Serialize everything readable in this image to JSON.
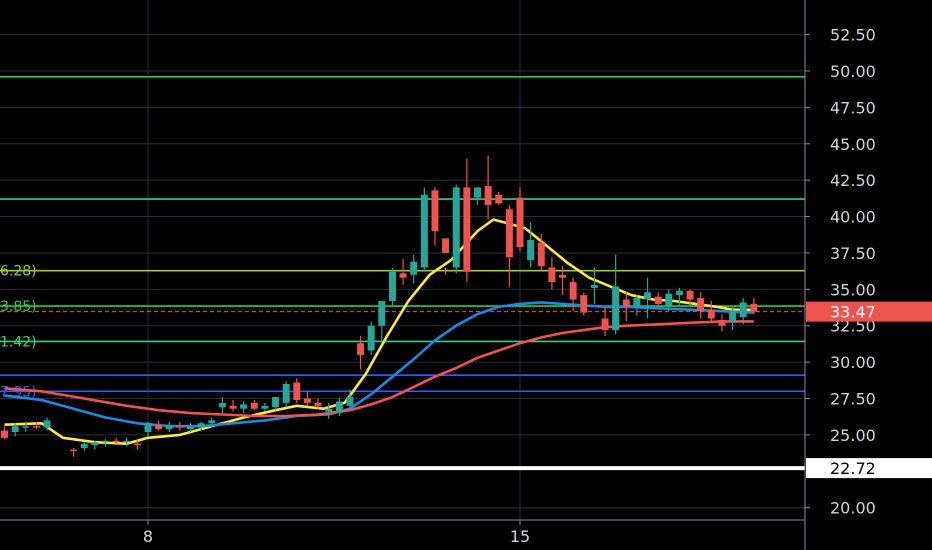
{
  "chart_data": {
    "type": "candlestick",
    "title": "",
    "xlabel": "",
    "ylabel": "",
    "ylim": [
      19.5,
      53.5
    ],
    "y_ticks": [
      "52.50",
      "50.00",
      "47.50",
      "45.00",
      "42.50",
      "40.00",
      "37.50",
      "35.00",
      "32.50",
      "30.00",
      "27.50",
      "25.00",
      "20.00"
    ],
    "x_ticks": [
      {
        "x": 8,
        "label": "8"
      },
      {
        "x": 15,
        "label": "15"
      }
    ],
    "x_range": [
      5.25,
      17.47
    ],
    "grid": true,
    "price_tag": {
      "value": 33.47,
      "label": "33.47",
      "color": "#ef5350"
    },
    "low_tag": {
      "value": 22.72,
      "label": "22.72",
      "color": "#ffffff"
    },
    "horizontal_levels": [
      {
        "value": 49.6,
        "color": "#2ecc40",
        "label": ""
      },
      {
        "value": 41.2,
        "color": "#3ccf7a",
        "label": ""
      },
      {
        "value": 36.28,
        "color": "#9acd32",
        "label": "6.28)"
      },
      {
        "value": 33.85,
        "color": "#2ecc40",
        "label": "3.85)"
      },
      {
        "value": 31.42,
        "color": "#3ccf7a",
        "label": "1.42)"
      },
      {
        "value": 29.1,
        "color": "#2962ff",
        "label": ""
      },
      {
        "value": 28.0,
        "color": "#2962ff",
        "label": "7.95)"
      }
    ],
    "candles": [
      [
        5.3,
        25.3,
        25.6,
        24.7,
        24.8
      ],
      [
        5.5,
        25.2,
        25.8,
        24.9,
        25.6
      ],
      [
        5.7,
        25.5,
        25.9,
        25.2,
        25.6
      ],
      [
        5.9,
        25.6,
        25.9,
        25.4,
        25.5
      ],
      [
        6.1,
        25.5,
        26.2,
        25.3,
        26.0
      ],
      [
        6.6,
        24.0,
        24.1,
        23.5,
        23.9
      ],
      [
        6.8,
        24.1,
        24.5,
        23.9,
        24.4
      ],
      [
        7.0,
        24.3,
        24.6,
        24.0,
        24.5
      ],
      [
        7.2,
        24.5,
        24.7,
        24.2,
        24.6
      ],
      [
        7.4,
        24.6,
        24.8,
        24.3,
        24.5
      ],
      [
        7.6,
        24.5,
        24.8,
        24.2,
        24.6
      ],
      [
        7.8,
        24.4,
        24.7,
        24.0,
        24.3
      ],
      [
        8.0,
        25.2,
        25.9,
        24.9,
        25.8
      ],
      [
        8.2,
        25.7,
        26.0,
        25.3,
        25.4
      ],
      [
        8.4,
        25.4,
        25.9,
        25.2,
        25.7
      ],
      [
        8.6,
        25.6,
        25.9,
        25.3,
        25.5
      ],
      [
        8.8,
        25.4,
        25.8,
        25.2,
        25.6
      ],
      [
        9.0,
        25.5,
        25.9,
        25.3,
        25.8
      ],
      [
        9.2,
        25.8,
        26.2,
        25.5,
        26.0
      ],
      [
        9.4,
        26.9,
        27.6,
        26.5,
        27.2
      ],
      [
        9.6,
        27.0,
        27.4,
        26.6,
        26.8
      ],
      [
        9.8,
        26.8,
        27.3,
        26.5,
        27.1
      ],
      [
        10.0,
        27.2,
        27.4,
        26.7,
        26.8
      ],
      [
        10.2,
        26.8,
        27.2,
        26.6,
        27.0
      ],
      [
        10.4,
        26.9,
        27.6,
        26.7,
        27.6
      ],
      [
        10.6,
        27.2,
        28.7,
        26.9,
        28.5
      ],
      [
        10.8,
        28.6,
        28.9,
        27.2,
        27.4
      ],
      [
        11.0,
        27.5,
        28.0,
        27.0,
        27.2
      ],
      [
        11.2,
        27.2,
        27.5,
        26.8,
        27.0
      ],
      [
        11.4,
        26.6,
        27.2,
        26.1,
        26.8
      ],
      [
        11.6,
        26.5,
        27.5,
        26.3,
        27.3
      ],
      [
        11.8,
        27.0,
        28.1,
        26.7,
        27.6
      ],
      [
        12.0,
        31.3,
        31.8,
        29.5,
        30.5
      ],
      [
        12.2,
        30.8,
        32.8,
        30.5,
        32.5
      ],
      [
        12.4,
        32.5,
        34.0,
        31.5,
        34.2
      ],
      [
        12.6,
        34.2,
        36.5,
        33.8,
        36.2
      ],
      [
        12.8,
        36.1,
        37.1,
        35.3,
        35.8
      ],
      [
        13.0,
        36.0,
        37.4,
        35.4,
        36.9
      ],
      [
        13.2,
        36.5,
        42.0,
        36.2,
        41.5
      ],
      [
        13.4,
        41.8,
        42.0,
        38.0,
        39.0
      ],
      [
        13.6,
        38.5,
        36.5,
        36.0,
        37.5
      ],
      [
        13.8,
        36.5,
        42.2,
        36.1,
        42.0
      ],
      [
        14.0,
        42.0,
        44.0,
        35.5,
        36.2
      ],
      [
        14.2,
        41.3,
        42.0,
        40.8,
        42.0
      ],
      [
        14.4,
        42.1,
        44.2,
        39.8,
        40.8
      ],
      [
        14.6,
        41.5,
        41.7,
        40.8,
        40.9
      ],
      [
        14.8,
        40.5,
        40.8,
        35.2,
        37.2
      ],
      [
        15.0,
        41.3,
        42.0,
        37.6,
        37.9
      ],
      [
        15.2,
        37.0,
        39.6,
        36.5,
        38.4
      ],
      [
        15.4,
        38.2,
        38.8,
        36.3,
        36.6
      ],
      [
        15.6,
        36.5,
        37.2,
        35.0,
        35.5
      ],
      [
        15.8,
        36.0,
        36.6,
        34.6,
        35.8
      ],
      [
        16.0,
        35.5,
        35.8,
        33.5,
        34.3
      ],
      [
        16.2,
        34.6,
        34.8,
        33.2,
        33.4
      ],
      [
        16.4,
        35.1,
        36.5,
        34.0,
        35.3
      ],
      [
        16.6,
        33.0,
        33.8,
        31.8,
        32.2
      ],
      [
        16.8,
        32.2,
        37.4,
        31.9,
        35.2
      ],
      [
        17.0,
        34.3,
        34.8,
        32.8,
        33.8
      ],
      [
        17.2,
        33.8,
        34.6,
        33.2,
        34.4
      ],
      [
        17.4,
        34.3,
        35.8,
        33.0,
        34.8
      ],
      [
        17.6,
        34.5,
        34.8,
        33.8,
        34.0
      ],
      [
        17.8,
        33.9,
        35.0,
        33.5,
        34.7
      ],
      [
        18.0,
        34.6,
        35.1,
        33.8,
        34.9
      ],
      [
        18.2,
        34.9,
        35.0,
        33.9,
        34.3
      ],
      [
        18.4,
        34.4,
        34.8,
        33.0,
        33.5
      ],
      [
        18.6,
        33.6,
        34.2,
        32.7,
        33.0
      ],
      [
        18.8,
        32.9,
        33.3,
        32.1,
        32.5
      ],
      [
        19.0,
        32.8,
        33.8,
        32.2,
        33.5
      ],
      [
        19.2,
        33.1,
        34.4,
        32.6,
        34.1
      ],
      [
        19.4,
        34.0,
        34.4,
        33.3,
        33.47
      ]
    ],
    "series": [
      {
        "color": "#ffeb3b",
        "values": [
          [
            5.3,
            25.7
          ],
          [
            6.0,
            25.8
          ],
          [
            6.4,
            24.8
          ],
          [
            7.0,
            24.5
          ],
          [
            7.6,
            24.4
          ],
          [
            8.0,
            24.8
          ],
          [
            8.6,
            25.0
          ],
          [
            9.2,
            25.6
          ],
          [
            9.8,
            26.2
          ],
          [
            10.4,
            26.7
          ],
          [
            10.8,
            27.0
          ],
          [
            11.3,
            26.8
          ],
          [
            11.7,
            27.2
          ],
          [
            12.1,
            29.2
          ],
          [
            12.5,
            31.8
          ],
          [
            12.9,
            34.2
          ],
          [
            13.3,
            36.0
          ],
          [
            13.7,
            37.0
          ],
          [
            14.2,
            39.0
          ],
          [
            14.5,
            39.8
          ],
          [
            14.8,
            39.5
          ],
          [
            15.1,
            39.2
          ],
          [
            15.5,
            38.0
          ],
          [
            15.9,
            36.8
          ],
          [
            16.3,
            35.8
          ],
          [
            16.7,
            35.2
          ],
          [
            17.1,
            34.6
          ],
          [
            17.5,
            34.3
          ],
          [
            17.9,
            34.2
          ],
          [
            18.3,
            34.0
          ],
          [
            18.7,
            33.8
          ],
          [
            19.0,
            33.6
          ],
          [
            19.4,
            33.6
          ]
        ]
      },
      {
        "color": "#1e88e5",
        "values": [
          [
            5.3,
            27.7
          ],
          [
            6.0,
            27.4
          ],
          [
            6.6,
            26.8
          ],
          [
            7.2,
            26.2
          ],
          [
            7.8,
            25.8
          ],
          [
            8.4,
            25.6
          ],
          [
            9.0,
            25.6
          ],
          [
            9.6,
            25.8
          ],
          [
            10.2,
            26.0
          ],
          [
            10.8,
            26.3
          ],
          [
            11.4,
            26.4
          ],
          [
            11.8,
            26.8
          ],
          [
            12.2,
            27.8
          ],
          [
            12.6,
            29.0
          ],
          [
            13.0,
            30.2
          ],
          [
            13.4,
            31.5
          ],
          [
            13.8,
            32.5
          ],
          [
            14.2,
            33.3
          ],
          [
            14.6,
            33.8
          ],
          [
            15.0,
            34.0
          ],
          [
            15.4,
            34.1
          ],
          [
            15.8,
            34.0
          ],
          [
            16.2,
            33.9
          ],
          [
            16.6,
            33.8
          ],
          [
            17.0,
            33.8
          ],
          [
            17.6,
            33.7
          ],
          [
            18.2,
            33.6
          ],
          [
            18.8,
            33.5
          ],
          [
            19.4,
            33.4
          ]
        ]
      },
      {
        "color": "#ef5350",
        "values": [
          [
            5.3,
            28.2
          ],
          [
            6.0,
            28.0
          ],
          [
            6.8,
            27.5
          ],
          [
            7.6,
            27.0
          ],
          [
            8.2,
            26.7
          ],
          [
            8.8,
            26.5
          ],
          [
            9.4,
            26.4
          ],
          [
            10.0,
            26.3
          ],
          [
            10.6,
            26.3
          ],
          [
            11.2,
            26.4
          ],
          [
            11.8,
            26.7
          ],
          [
            12.2,
            27.1
          ],
          [
            12.6,
            27.6
          ],
          [
            13.0,
            28.3
          ],
          [
            13.4,
            29.0
          ],
          [
            13.8,
            29.6
          ],
          [
            14.2,
            30.3
          ],
          [
            14.6,
            30.8
          ],
          [
            15.0,
            31.3
          ],
          [
            15.4,
            31.7
          ],
          [
            15.8,
            32.0
          ],
          [
            16.2,
            32.2
          ],
          [
            16.6,
            32.4
          ],
          [
            17.0,
            32.5
          ],
          [
            17.6,
            32.6
          ],
          [
            18.2,
            32.7
          ],
          [
            18.8,
            32.8
          ],
          [
            19.4,
            32.8
          ]
        ]
      }
    ]
  }
}
